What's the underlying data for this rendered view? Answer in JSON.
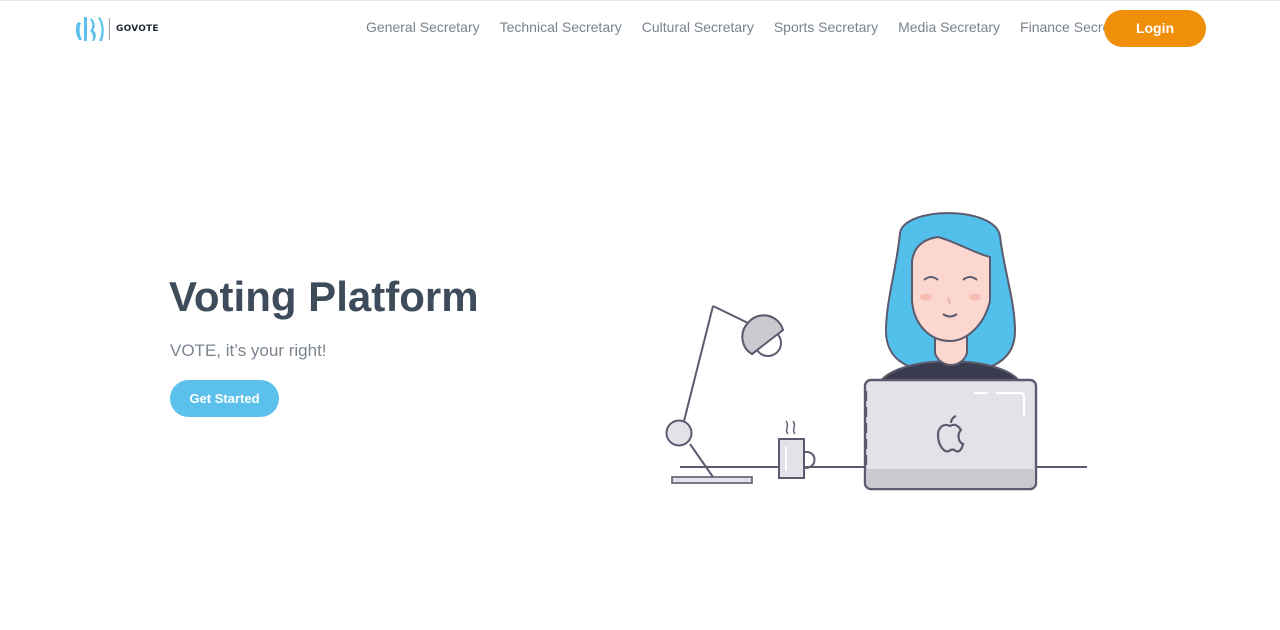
{
  "brand": {
    "name": "GOVOTE",
    "logo_icon": "govote-logo-icon",
    "accent_color": "#5bc0eb"
  },
  "nav": {
    "links": [
      {
        "label": "General Secretary"
      },
      {
        "label": "Technical Secretary"
      },
      {
        "label": "Cultural Secretary"
      },
      {
        "label": "Sports Secretary"
      },
      {
        "label": "Media Secretary"
      },
      {
        "label": "Finance Secretary"
      }
    ],
    "login_label": "Login",
    "login_color": "#f0900a"
  },
  "hero": {
    "title": "Voting Platform",
    "subtitle": "VOTE, it’s your right!",
    "cta_label": "Get Started",
    "cta_color": "#5bc0eb"
  },
  "illustration": {
    "icon": "woman-at-laptop-illustration",
    "elements": [
      "desk-lamp-icon",
      "coffee-mug-icon",
      "laptop-icon",
      "apple-logo-icon"
    ]
  }
}
